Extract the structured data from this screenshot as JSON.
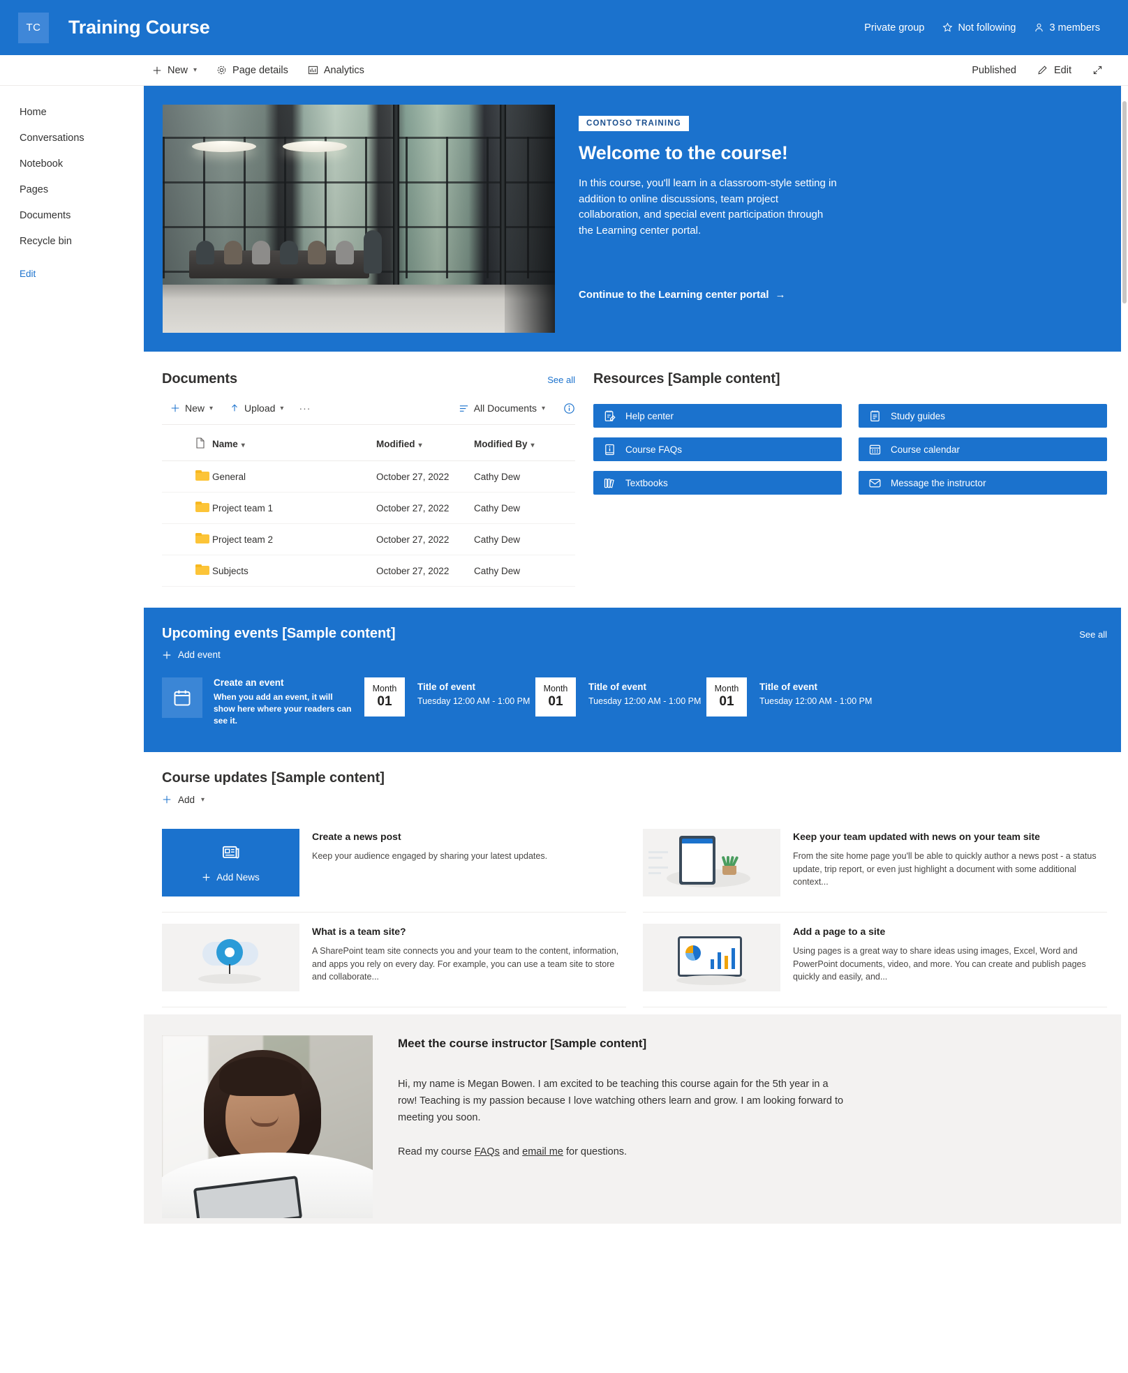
{
  "header": {
    "logo_initials": "TC",
    "site_title": "Training Course",
    "privacy": "Private group",
    "follow": "Not following",
    "members": "3 members"
  },
  "command_bar": {
    "new_label": "New",
    "page_details_label": "Page details",
    "analytics_label": "Analytics",
    "status": "Published",
    "edit_label": "Edit"
  },
  "sidebar": {
    "items": [
      {
        "label": "Home"
      },
      {
        "label": "Conversations"
      },
      {
        "label": "Notebook"
      },
      {
        "label": "Pages"
      },
      {
        "label": "Documents"
      },
      {
        "label": "Recycle bin"
      }
    ],
    "edit_label": "Edit"
  },
  "hero": {
    "tag": "CONTOSO TRAINING",
    "heading": "Welcome to the course!",
    "paragraph": "In this course, you'll learn in a classroom-style setting in addition to online discussions, team project collaboration, and special event participation through the Learning center portal.",
    "cta": "Continue to the Learning center portal",
    "cta_arrow": "→"
  },
  "documents": {
    "title": "Documents",
    "see_all": "See all",
    "toolbar": {
      "new_label": "New",
      "upload_label": "Upload",
      "more_label": "···",
      "view_label": "All Documents"
    },
    "columns": [
      "Name",
      "Modified",
      "Modified By"
    ],
    "rows": [
      {
        "name": "General",
        "modified": "October 27, 2022",
        "modified_by": "Cathy Dew"
      },
      {
        "name": "Project team 1",
        "modified": "October 27, 2022",
        "modified_by": "Cathy Dew"
      },
      {
        "name": "Project team 2",
        "modified": "October 27, 2022",
        "modified_by": "Cathy Dew"
      },
      {
        "name": "Subjects",
        "modified": "October 27, 2022",
        "modified_by": "Cathy Dew"
      }
    ]
  },
  "resources": {
    "title": "Resources [Sample content]",
    "buttons": [
      {
        "label": "Help center",
        "icon": "notepad-pencil-icon"
      },
      {
        "label": "Study guides",
        "icon": "notepad-icon"
      },
      {
        "label": "Course FAQs",
        "icon": "info-book-icon"
      },
      {
        "label": "Course calendar",
        "icon": "calendar-icon"
      },
      {
        "label": "Textbooks",
        "icon": "books-icon"
      },
      {
        "label": "Message the instructor",
        "icon": "mail-icon"
      }
    ]
  },
  "events": {
    "title": "Upcoming events [Sample content]",
    "see_all": "See all",
    "add_event": "Add event",
    "create": {
      "title": "Create an event",
      "description": "When you add an event, it will show here where your readers can see it."
    },
    "items": [
      {
        "month": "Month",
        "day": "01",
        "title": "Title of event",
        "time": "Tuesday 12:00 AM - 1:00 PM"
      },
      {
        "month": "Month",
        "day": "01",
        "title": "Title of event",
        "time": "Tuesday 12:00 AM - 1:00 PM"
      },
      {
        "month": "Month",
        "day": "01",
        "title": "Title of event",
        "time": "Tuesday 12:00 AM - 1:00 PM"
      }
    ]
  },
  "news": {
    "title": "Course updates [Sample content]",
    "add_label": "Add",
    "add_news_label": "Add News",
    "cards": [
      {
        "title": "Create a news post",
        "description": "Keep your audience engaged by sharing your latest updates."
      },
      {
        "title": "Keep your team updated with news on your team site",
        "description": "From the site home page you'll be able to quickly author a news post - a status update, trip report, or even just highlight a document with some additional context..."
      },
      {
        "title": "What is a team site?",
        "description": "A SharePoint team site connects you and your team to the content, information, and apps you rely on every day. For example, you can use a team site to store and collaborate..."
      },
      {
        "title": "Add a page to a site",
        "description": "Using pages is a great way to share ideas using images, Excel, Word and PowerPoint documents, video, and more. You can create and publish pages quickly and easily, and..."
      }
    ]
  },
  "instructor": {
    "title": "Meet the course instructor [Sample content]",
    "paragraph": "Hi, my name is Megan Bowen. I am excited to be teaching this course again for the 5th year in a row! Teaching is my passion because I love watching others learn and grow. I am looking forward to meeting you soon.",
    "footer_prefix": "Read my course ",
    "link_faqs": "FAQs",
    "footer_middle": " and ",
    "link_email": "email me",
    "footer_suffix": " for questions."
  },
  "colors": {
    "brand_blue": "#1b72cd",
    "folder_yellow": "#fcc438",
    "surface_gray": "#f3f2f1"
  }
}
